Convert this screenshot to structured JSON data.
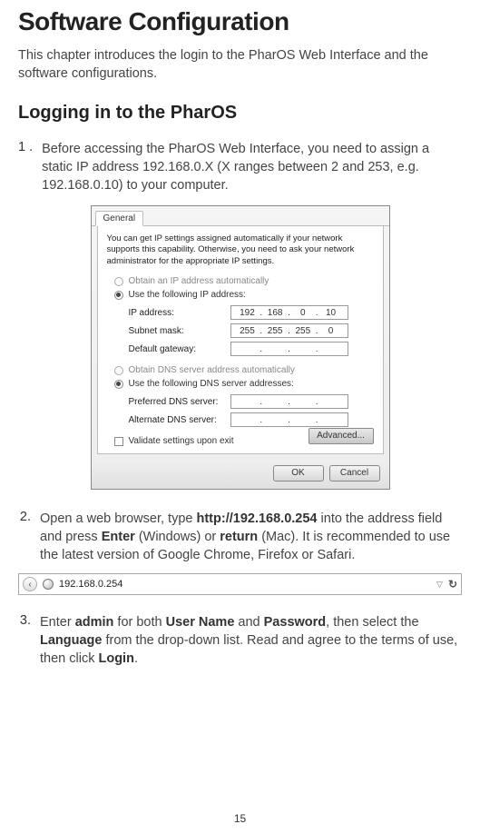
{
  "title": "Software Configuration",
  "intro": "This chapter introduces the login to the PharOS Web Interface and the software configurations.",
  "h2": "Logging in to the PharOS",
  "step1": {
    "num": "1 .",
    "text_a": "Before accessing the PharOS Web Interface, you need to assign a static IP address 192.168.0.X (X ranges between 2 and 253, e.g. 192.168.0.10) to your computer."
  },
  "dialog": {
    "tab": "General",
    "help": "You can get IP settings assigned automatically if your network supports this capability. Otherwise, you need to ask your network administrator for the appropriate IP settings.",
    "radio_auto_ip": "Obtain an IP address automatically",
    "radio_use_ip": "Use the following IP address:",
    "lbl_ip": "IP address:",
    "lbl_mask": "Subnet mask:",
    "lbl_gw": "Default gateway:",
    "ip": {
      "a": "192",
      "b": "168",
      "c": "0",
      "d": "10"
    },
    "mask": {
      "a": "255",
      "b": "255",
      "c": "255",
      "d": "0"
    },
    "radio_auto_dns": "Obtain DNS server address automatically",
    "radio_use_dns": "Use the following DNS server addresses:",
    "lbl_pdns": "Preferred DNS server:",
    "lbl_adns": "Alternate DNS server:",
    "chk_validate": "Validate settings upon exit",
    "btn_adv": "Advanced...",
    "btn_ok": "OK",
    "btn_cancel": "Cancel"
  },
  "step2": {
    "num": "2.",
    "a": "Open a web browser, type ",
    "url": "http://192.168.0.254",
    "b": " into the address field and press ",
    "enter": "Enter",
    "c": " (Windows) or ",
    "return": "return",
    "d": " (Mac). It is recommended to use the latest version of Google Chrome, Firefox or Safari."
  },
  "urlbar": {
    "back": "‹",
    "url": "192.168.0.254",
    "drop": "▽",
    "reload": "↻"
  },
  "step3": {
    "num": "3.",
    "a": "Enter ",
    "admin": "admin",
    "b": " for both ",
    "user": "User Name",
    "c": " and ",
    "pass": "Password",
    "d": ", then select the ",
    "lang": "Language",
    "e": " from the drop-down list. Read and agree to the terms of use, then click ",
    "login": "Login",
    "f": "."
  },
  "pagenum": "15"
}
